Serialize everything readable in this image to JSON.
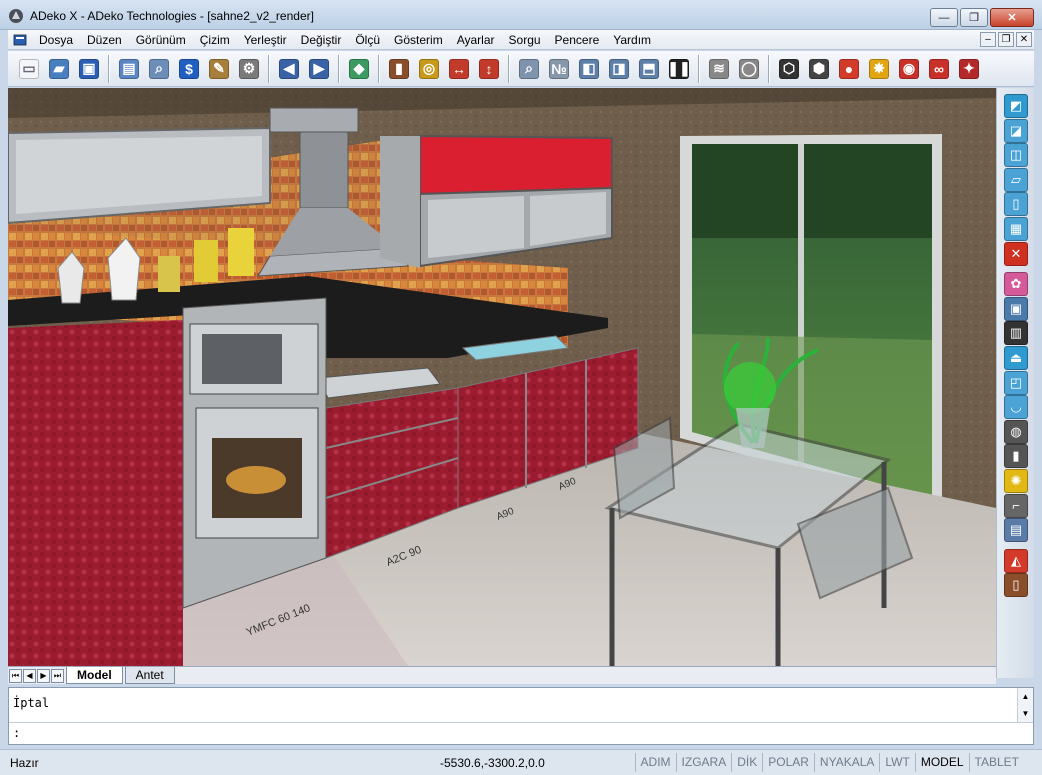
{
  "window": {
    "title": "ADeko X - ADeko Technologies - [sahne2_v2_render]",
    "minimize_glyph": "—",
    "restore_glyph": "❐",
    "close_glyph": "✕"
  },
  "menu": {
    "items": [
      "Dosya",
      "Düzen",
      "Görünüm",
      "Çizim",
      "Yerleştir",
      "Değiştir",
      "Ölçü",
      "Gösterim",
      "Ayarlar",
      "Sorgu",
      "Pencere",
      "Yardım"
    ],
    "mdi_minimize": "–",
    "mdi_restore": "❐",
    "mdi_close": "✕"
  },
  "toolbar": {
    "groups": [
      [
        {
          "icon": "new-file-icon",
          "glyph": "▭",
          "color": "#f4f6f9"
        },
        {
          "icon": "open-folder-icon",
          "glyph": "▰",
          "color": "#4a7fbf"
        },
        {
          "icon": "save-icon",
          "glyph": "▣",
          "color": "#2b5fb3"
        }
      ],
      [
        {
          "icon": "print-icon",
          "glyph": "▤",
          "color": "#5a86c2"
        },
        {
          "icon": "print-preview-icon",
          "glyph": "⌕",
          "color": "#6c8db7"
        },
        {
          "icon": "price-icon",
          "glyph": "$",
          "color": "#1f5fc0"
        },
        {
          "icon": "report-icon",
          "glyph": "✎",
          "color": "#a77f3a"
        },
        {
          "icon": "settings-icon",
          "glyph": "⚙",
          "color": "#7a7a7a"
        }
      ],
      [
        {
          "icon": "undo-icon",
          "glyph": "◀",
          "color": "#3a63a6"
        },
        {
          "icon": "redo-icon",
          "glyph": "▶",
          "color": "#3a63a6"
        }
      ],
      [
        {
          "icon": "eraser-icon",
          "glyph": "◆",
          "color": "#3c9a62"
        }
      ],
      [
        {
          "icon": "door-exit-icon",
          "glyph": "▮",
          "color": "#8a4f2a"
        },
        {
          "icon": "measure-tape-icon",
          "glyph": "◎",
          "color": "#c79a1c"
        },
        {
          "icon": "dimension-horizontal-icon",
          "glyph": "↔",
          "color": "#c23a2a"
        },
        {
          "icon": "dimension-vertical-icon",
          "glyph": "↕",
          "color": "#c23a2a"
        }
      ],
      [
        {
          "icon": "zoom-icon",
          "glyph": "⌕",
          "color": "#7f93ad"
        },
        {
          "icon": "numbering-icon",
          "glyph": "№",
          "color": "#8797aa"
        },
        {
          "icon": "view-front-icon",
          "glyph": "◧",
          "color": "#5d7fa8"
        },
        {
          "icon": "view-side-icon",
          "glyph": "◨",
          "color": "#5d7fa8"
        },
        {
          "icon": "view-top-icon",
          "glyph": "⬒",
          "color": "#5d7fa8"
        },
        {
          "icon": "walk-icon",
          "glyph": "❚❚",
          "color": "#222"
        }
      ],
      [
        {
          "icon": "layers-icon",
          "glyph": "≋",
          "color": "#888"
        },
        {
          "icon": "orbit-icon",
          "glyph": "◯",
          "color": "#888"
        }
      ],
      [
        {
          "icon": "wireframe-icon",
          "glyph": "⬡",
          "color": "#333"
        },
        {
          "icon": "hidden-line-icon",
          "glyph": "⬢",
          "color": "#444"
        },
        {
          "icon": "shaded-icon",
          "glyph": "●",
          "color": "#d23a2a"
        },
        {
          "icon": "light-icon",
          "glyph": "✸",
          "color": "#e2a514"
        },
        {
          "icon": "render-icon",
          "glyph": "◉",
          "color": "#c8302a"
        },
        {
          "icon": "stereo-glasses-icon",
          "glyph": "∞",
          "color": "#c8302a"
        },
        {
          "icon": "render-settings-icon",
          "glyph": "✦",
          "color": "#b42a2a"
        }
      ]
    ]
  },
  "right_toolbar": [
    {
      "icon": "cabinet-base-icon",
      "glyph": "◩",
      "color": "#2f9ad0"
    },
    {
      "icon": "cabinet-wall-icon",
      "glyph": "◪",
      "color": "#4aa3d4"
    },
    {
      "icon": "cabinet-tall-icon",
      "glyph": "◫",
      "color": "#4aa3d4"
    },
    {
      "icon": "worktop-icon",
      "glyph": "▱",
      "color": "#4aa3d4"
    },
    {
      "icon": "panel-icon",
      "glyph": "▯",
      "color": "#4aa3d4"
    },
    {
      "icon": "appliance-icon",
      "glyph": "▦",
      "color": "#4aa3d4"
    },
    {
      "icon": "delete-cabinet-icon",
      "glyph": "✕",
      "color": "#d03020"
    },
    {
      "icon": "decor-icon",
      "glyph": "✿",
      "color": "#d45a9a"
    },
    {
      "icon": "oven-icon",
      "glyph": "▣",
      "color": "#4a7aaa"
    },
    {
      "icon": "fridge-icon",
      "glyph": "▥",
      "color": "#333"
    },
    {
      "icon": "hood-icon",
      "glyph": "⏏",
      "color": "#2f9ad0"
    },
    {
      "icon": "corner-cabinet-icon",
      "glyph": "◰",
      "color": "#4aa3d4"
    },
    {
      "icon": "sink-icon",
      "glyph": "◡",
      "color": "#4aa3d4"
    },
    {
      "icon": "hob-icon",
      "glyph": "◍",
      "color": "#555"
    },
    {
      "icon": "bin-icon",
      "glyph": "▮",
      "color": "#555"
    },
    {
      "icon": "lamp-icon",
      "glyph": "✺",
      "color": "#e2b814"
    },
    {
      "icon": "faucet-icon",
      "glyph": "⌐",
      "color": "#666"
    },
    {
      "icon": "tile-icon",
      "glyph": "▤",
      "color": "#5a7aa8"
    },
    {
      "icon": "material-palette-icon",
      "glyph": "◭",
      "color": "#d43a2a"
    },
    {
      "icon": "door-icon",
      "glyph": "▯",
      "color": "#8a4f2a"
    }
  ],
  "scene": {
    "labels": [
      "YMFC 60 140",
      "A2C 90",
      "A90",
      "A90"
    ]
  },
  "tabs": {
    "first": "⏮",
    "prev": "◀",
    "next": "▶",
    "last": "⏭",
    "items": [
      {
        "label": "Model",
        "active": true
      },
      {
        "label": "Antet",
        "active": false
      }
    ]
  },
  "command": {
    "history": "İptal",
    "prompt": ":",
    "scroll_up": "▲",
    "scroll_down": "▼"
  },
  "status": {
    "text": "Hazır",
    "coordinates": "-5530.6,-3300.2,0.0",
    "toggles": [
      {
        "label": "ADIM",
        "on": false
      },
      {
        "label": "IZGARA",
        "on": false
      },
      {
        "label": "DİK",
        "on": false
      },
      {
        "label": "POLAR",
        "on": false
      },
      {
        "label": "NYAKALA",
        "on": false
      },
      {
        "label": "LWT",
        "on": false
      },
      {
        "label": "MODEL",
        "on": true
      },
      {
        "label": "TABLET",
        "on": false
      }
    ]
  }
}
